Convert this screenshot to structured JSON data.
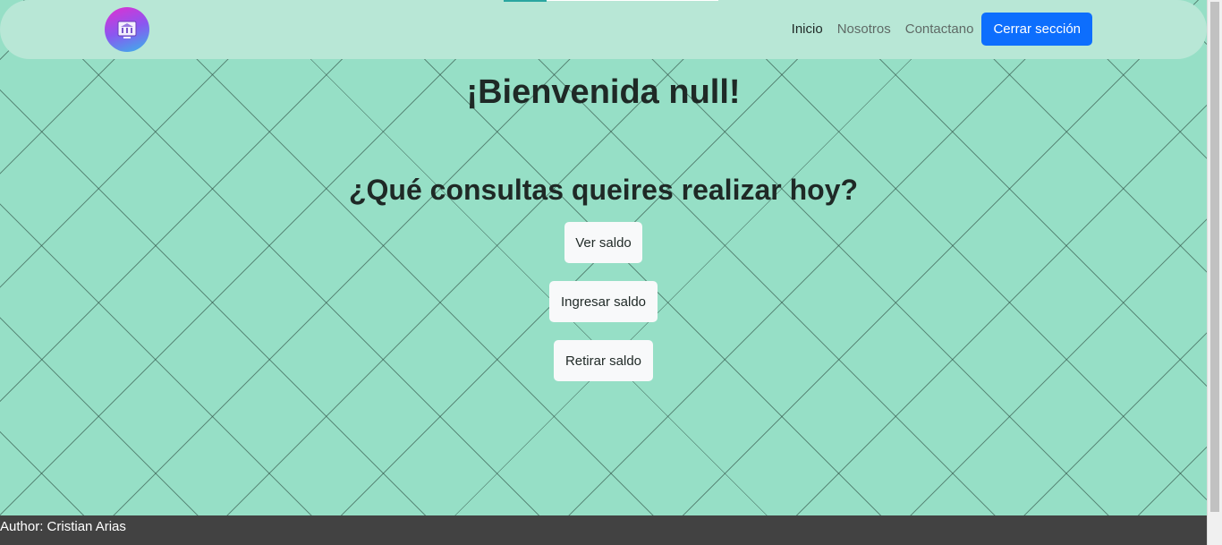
{
  "nav": {
    "links": [
      "Inicio",
      "Nosotros",
      "Contactano"
    ],
    "logout_label": "Cerrar sección"
  },
  "main": {
    "welcome": "¡Bienvenida null!",
    "question": "¿Qué consultas queires realizar hoy?",
    "actions": [
      "Ver saldo",
      "Ingresar saldo",
      "Retirar saldo"
    ]
  },
  "footer": {
    "author": "Author: Cristian Arias"
  },
  "icons": {
    "logo": "bank-icon"
  },
  "colors": {
    "background": "#96dfc6",
    "navbar": "#b8e7d6",
    "primary_button": "#0d6efd",
    "footer": "#424242"
  }
}
